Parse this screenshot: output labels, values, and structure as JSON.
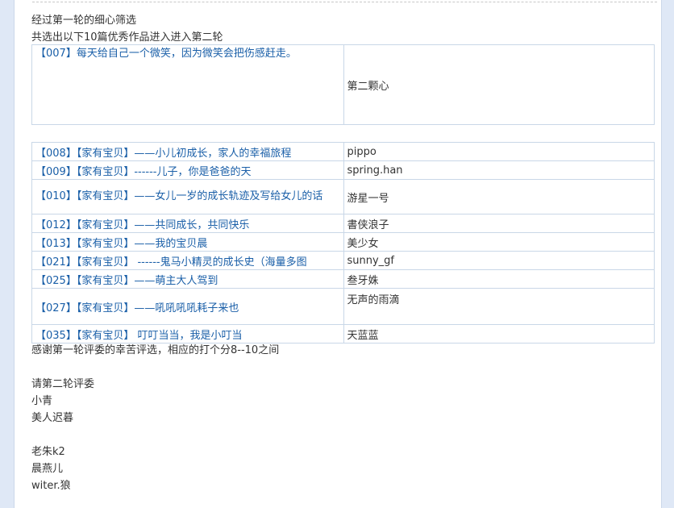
{
  "intro": {
    "line1": "经过第一轮的细心筛选",
    "line2": "共选出以下10篇优秀作品进入进入第二轮"
  },
  "featured": {
    "title": "【007】每天给自己一个微笑，因为微笑会把伤感赶走。",
    "author": "第二颗心"
  },
  "entries": [
    {
      "title": "【008】【家有宝贝】——小儿初成长，家人的幸福旅程",
      "author": "pippo"
    },
    {
      "title": "【009】【家有宝贝】------儿子，你是爸爸的天",
      "author": "spring.han"
    },
    {
      "title": "【010】【家有宝贝】——女儿一岁的成长轨迹及写给女儿的话",
      "author": "游星一号"
    },
    {
      "title": "【012】【家有宝贝】——共同成长，共同快乐",
      "author": "書侠浪子"
    },
    {
      "title": "【013】【家有宝贝】——我的宝贝晨",
      "author": "美少女"
    },
    {
      "title": "【021】【家有宝贝】 ------鬼马小精灵的成长史（海量多图",
      "author": "sunny_gf"
    },
    {
      "title": "【025】【家有宝贝】——萌主大人驾到",
      "author": "叁牙姝"
    },
    {
      "title": "【027】【家有宝贝】——吼吼吼吼耗子来也",
      "author": "无声的雨滴"
    },
    {
      "title": "【035】【家有宝贝】 叮叮当当，我是小叮当",
      "author": "天蓝蓝"
    }
  ],
  "closing": {
    "thanks": "感谢第一轮评委的幸苦评选，相应的打个分8--10之间",
    "invite": "请第二轮评委",
    "judges_a": [
      "小青",
      "美人迟暮"
    ],
    "judges_b": [
      "老朱k2",
      "晨燕儿",
      "witer.狼"
    ]
  }
}
